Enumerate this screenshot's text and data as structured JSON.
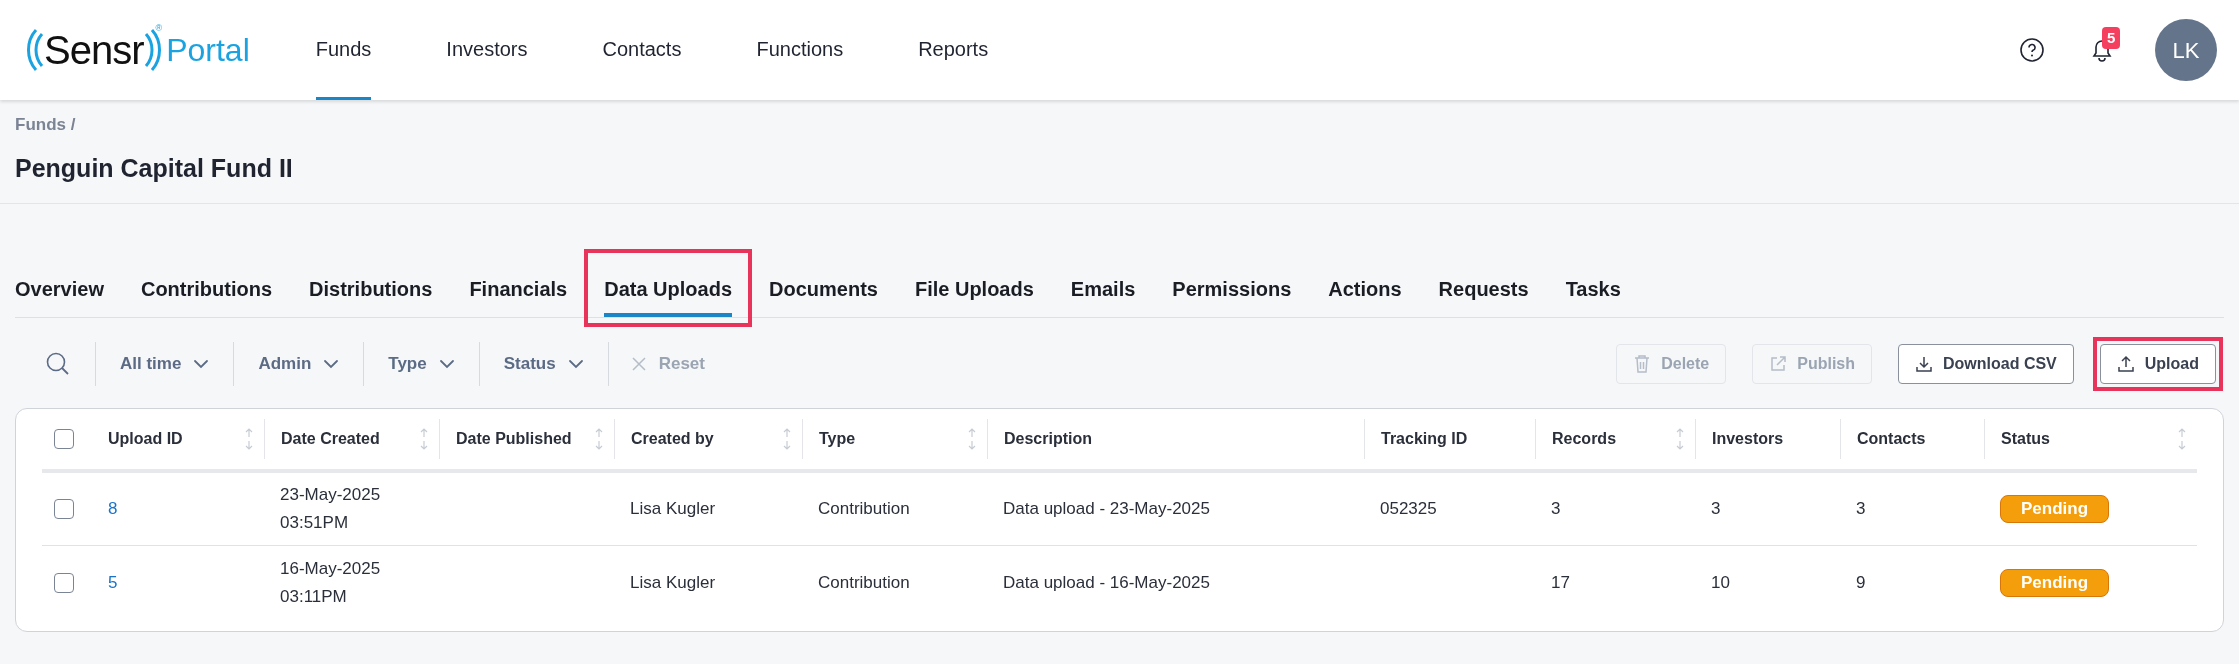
{
  "header": {
    "logo": {
      "brand": "Sensr",
      "mark": "®",
      "product": "Portal"
    },
    "nav": [
      {
        "label": "Funds",
        "selected": true
      },
      {
        "label": "Investors",
        "selected": false
      },
      {
        "label": "Contacts",
        "selected": false
      },
      {
        "label": "Functions",
        "selected": false
      },
      {
        "label": "Reports",
        "selected": false
      }
    ],
    "notifications": {
      "count": "5"
    },
    "avatar": {
      "initials": "LK"
    }
  },
  "breadcrumb": "Funds /",
  "title": "Penguin Capital Fund II",
  "tabs": [
    {
      "label": "Overview",
      "selected": false,
      "highlighted": false
    },
    {
      "label": "Contributions",
      "selected": false,
      "highlighted": false
    },
    {
      "label": "Distributions",
      "selected": false,
      "highlighted": false
    },
    {
      "label": "Financials",
      "selected": false,
      "highlighted": false
    },
    {
      "label": "Data Uploads",
      "selected": true,
      "highlighted": true
    },
    {
      "label": "Documents",
      "selected": false,
      "highlighted": false
    },
    {
      "label": "File Uploads",
      "selected": false,
      "highlighted": false
    },
    {
      "label": "Emails",
      "selected": false,
      "highlighted": false
    },
    {
      "label": "Permissions",
      "selected": false,
      "highlighted": false
    },
    {
      "label": "Actions",
      "selected": false,
      "highlighted": false
    },
    {
      "label": "Requests",
      "selected": false,
      "highlighted": false
    },
    {
      "label": "Tasks",
      "selected": false,
      "highlighted": false
    }
  ],
  "filters": [
    {
      "label": "All time"
    },
    {
      "label": "Admin"
    },
    {
      "label": "Type"
    },
    {
      "label": "Status"
    }
  ],
  "reset": {
    "label": "Reset",
    "disabled": true
  },
  "actions": [
    {
      "kind": "delete",
      "label": "Delete",
      "disabled": true,
      "highlighted": false
    },
    {
      "kind": "publish",
      "label": "Publish",
      "disabled": true,
      "highlighted": false
    },
    {
      "kind": "download",
      "label": "Download CSV",
      "disabled": false,
      "highlighted": false
    },
    {
      "kind": "upload",
      "label": "Upload",
      "disabled": false,
      "highlighted": true
    }
  ],
  "table": {
    "select_all": {
      "checked": false
    },
    "columns": [
      {
        "label": "Upload ID",
        "sortable": true
      },
      {
        "label": "Date Created",
        "sortable": true
      },
      {
        "label": "Date Published",
        "sortable": true
      },
      {
        "label": "Created by",
        "sortable": true
      },
      {
        "label": "Type",
        "sortable": true
      },
      {
        "label": "Description",
        "sortable": false
      },
      {
        "label": "Tracking ID",
        "sortable": false
      },
      {
        "label": "Records",
        "sortable": true
      },
      {
        "label": "Investors",
        "sortable": false
      },
      {
        "label": "Contacts",
        "sortable": false
      },
      {
        "label": "Status",
        "sortable": true
      }
    ],
    "rows": [
      {
        "checked": false,
        "upload_id": "8",
        "date_created": [
          "23-May-2025",
          "03:51PM"
        ],
        "created_by": "Lisa Kugler",
        "type": "Contribution",
        "description": "Data upload - 23-May-2025",
        "tracking_id": "052325",
        "records": "3",
        "investors": "3",
        "contacts": "3",
        "status": "Pending"
      },
      {
        "checked": false,
        "upload_id": "5",
        "date_created": [
          "16-May-2025",
          "03:11PM"
        ],
        "created_by": "Lisa Kugler",
        "type": "Contribution",
        "description": "Data upload - 16-May-2025",
        "records": "17",
        "investors": "10",
        "contacts": "9",
        "status": "Pending"
      }
    ]
  }
}
